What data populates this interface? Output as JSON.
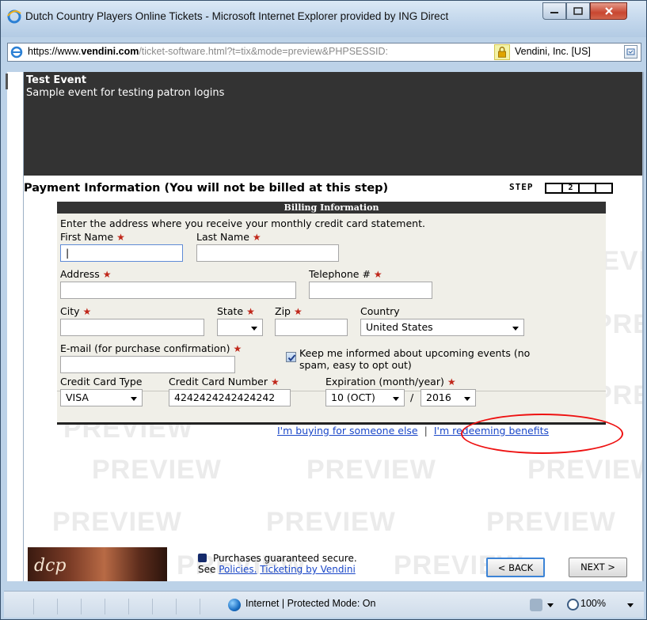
{
  "window": {
    "title": "Dutch Country Players Online Tickets - Microsoft Internet Explorer provided by ING Direct",
    "min_glyph": "—",
    "max_glyph": "☐",
    "close_glyph": "X"
  },
  "address_bar": {
    "url_scheme": "https://www.",
    "url_domain": "vendini.com",
    "url_rest": "/ticket-software.html?t=tix&mode=preview&PHPSESSID:",
    "certificate": "Vendini, Inc. [US]"
  },
  "event": {
    "title": "Test Event",
    "description": "Sample event for testing patron logins"
  },
  "payment": {
    "heading": "Payment Information (You will not be billed at this step)",
    "step_label": "STEP",
    "steps": [
      "",
      "2",
      "",
      ""
    ]
  },
  "billing": {
    "header": "Billing Information",
    "instructions": "Enter the address where you receive your monthly credit card statement.",
    "first_name_label": "First Name",
    "first_name_value": "|",
    "last_name_label": "Last Name",
    "last_name_value": "",
    "address_label": "Address",
    "address_value": "",
    "telephone_label": "Telephone #",
    "telephone_value": "",
    "city_label": "City",
    "city_value": "",
    "state_label": "State",
    "state_value": "",
    "zip_label": "Zip",
    "zip_value": "",
    "country_label": "Country",
    "country_value": "United States",
    "email_label": "E-mail (for purchase confirmation)",
    "email_value": "",
    "keep_informed_line1": "Keep me informed about upcoming events (no",
    "keep_informed_line2": "spam, easy to opt out)",
    "keep_informed_checked": true,
    "cc_type_label": "Credit Card Type",
    "cc_type_value": "VISA",
    "cc_number_label": "Credit Card Number",
    "cc_number_value": "4242424242424242",
    "expiration_label": "Expiration (month/year)",
    "exp_month_value": "10 (OCT)",
    "exp_separator": "/",
    "exp_year_value": "2016",
    "required_glyph": "★"
  },
  "links": {
    "buying_for_someone": "I'm buying for someone else",
    "separator": "|",
    "redeeming_benefits": "I'm redeeming benefits"
  },
  "footer": {
    "logo_text": "dcp",
    "secure_line1": "Purchases guaranteed secure.",
    "see_text": "See ",
    "policies_link": "Policies.",
    "ticketing_link": "Ticketing by Vendini",
    "back_button": "< BACK",
    "next_button": "NEXT >"
  },
  "watermark": "PREVIEW",
  "status_bar": {
    "zone": "Internet | Protected Mode: On",
    "zoom": "100%"
  },
  "colors": {
    "header_bg": "#333333",
    "billing_bg": "#f0efe8",
    "required_star": "#c0271a",
    "link": "#1a47c8",
    "annotation_oval": "#ee1111"
  }
}
